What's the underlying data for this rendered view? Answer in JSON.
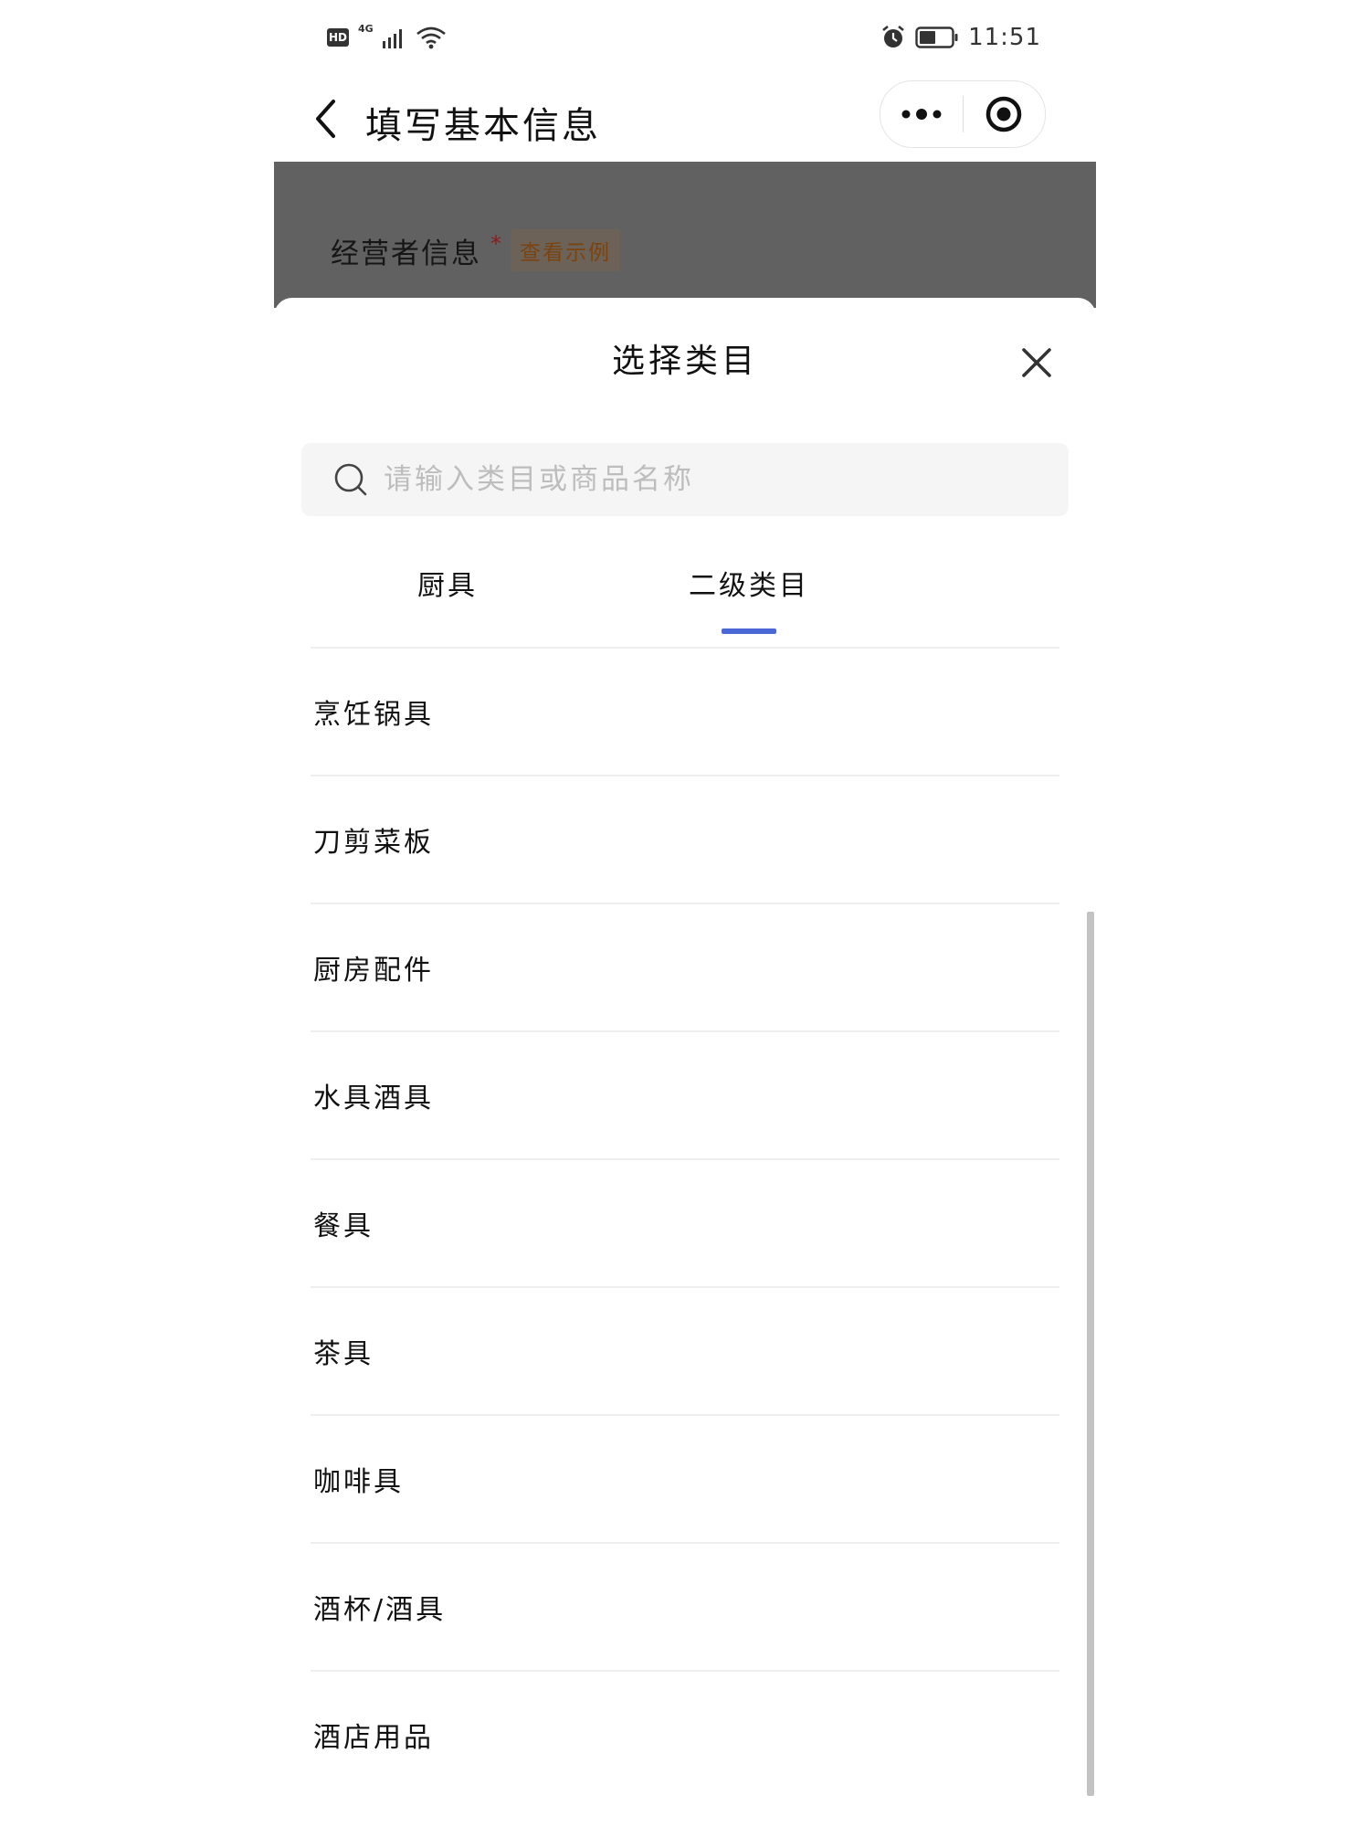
{
  "status_bar": {
    "hd_label": "HD",
    "network_label": "4G",
    "time": "11:51",
    "icons": [
      "signal-icon",
      "wifi-icon",
      "alarm-icon",
      "battery-icon"
    ]
  },
  "nav": {
    "title": "填写基本信息",
    "icons": [
      "back-icon",
      "more-icon",
      "target-icon"
    ]
  },
  "background_page": {
    "section_label": "经营者信息",
    "required_mark": "*",
    "example_link": "查看示例"
  },
  "sheet": {
    "title": "选择类目",
    "search": {
      "placeholder": "请输入类目或商品名称",
      "value": ""
    },
    "tabs": [
      {
        "label": "厨具",
        "active": false
      },
      {
        "label": "二级类目",
        "active": true
      }
    ],
    "items": [
      "烹饪锅具",
      "刀剪菜板",
      "厨房配件",
      "水具酒具",
      "餐具",
      "茶具",
      "咖啡具",
      "酒杯/酒具",
      "酒店用品"
    ]
  },
  "colors": {
    "accent": "#4a69d6",
    "overlay": "#616161",
    "divider": "#eeeeee"
  }
}
